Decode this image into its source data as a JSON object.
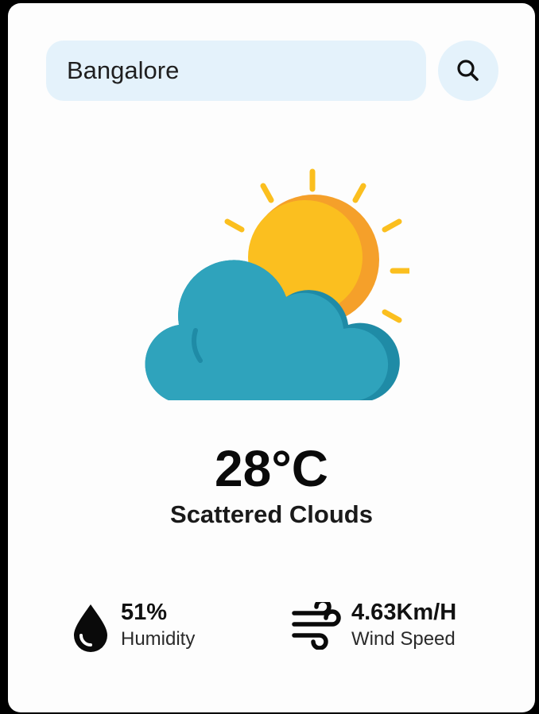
{
  "search": {
    "value": "Bangalore",
    "icon": "search-icon"
  },
  "weather": {
    "icon": "sun-behind-cloud-icon",
    "temperature": "28°C",
    "condition": "Scattered Clouds"
  },
  "humidity": {
    "icon": "water-drop-icon",
    "value": "51%",
    "label": "Humidity"
  },
  "wind": {
    "icon": "wind-icon",
    "value": "4.63Km/H",
    "label": "Wind Speed"
  },
  "colors": {
    "card_background": "#fdfdfd",
    "search_background": "#e4f2fb",
    "sun": "#fbbf1f",
    "sun_shade": "#f5a02a",
    "cloud": "#2fa3bc",
    "cloud_shade": "#1f8ba6"
  }
}
